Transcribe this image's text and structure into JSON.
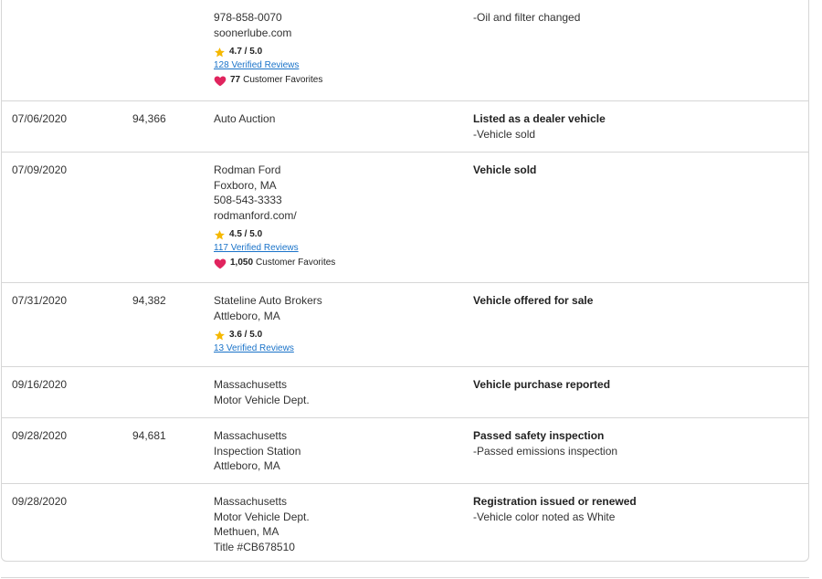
{
  "records": [
    {
      "date": "",
      "mileage": "",
      "source": [
        "978-858-0070",
        "soonerlube.com"
      ],
      "rating": "4.7 / 5.0",
      "reviews": "128 Verified Reviews",
      "favorites_count": "77",
      "favorites_label": "Customer Favorites",
      "title": "",
      "subs": [
        "-Oil and filter changed"
      ]
    },
    {
      "date": "07/06/2020",
      "mileage": "94,366",
      "source": [
        "Auto Auction"
      ],
      "title": "Listed as a dealer vehicle",
      "subs": [
        "-Vehicle sold"
      ]
    },
    {
      "date": "07/09/2020",
      "mileage": "",
      "source": [
        "Rodman Ford",
        "Foxboro, MA",
        "508-543-3333",
        "rodmanford.com/"
      ],
      "rating": "4.5 / 5.0",
      "reviews": "117 Verified Reviews",
      "favorites_count": "1,050",
      "favorites_label": "Customer Favorites",
      "title": "Vehicle sold",
      "subs": []
    },
    {
      "date": "07/31/2020",
      "mileage": "94,382",
      "source": [
        "Stateline Auto Brokers",
        "Attleboro, MA"
      ],
      "rating": "3.6 / 5.0",
      "reviews": "13 Verified Reviews",
      "title": "Vehicle offered for sale",
      "subs": []
    },
    {
      "date": "09/16/2020",
      "mileage": "",
      "source": [
        "Massachusetts",
        "Motor Vehicle Dept."
      ],
      "title": "Vehicle purchase reported",
      "subs": []
    },
    {
      "date": "09/28/2020",
      "mileage": "94,681",
      "source": [
        "Massachusetts",
        "Inspection Station",
        "Attleboro, MA"
      ],
      "title": "Passed safety inspection",
      "subs": [
        "-Passed emissions inspection"
      ]
    },
    {
      "date": "09/28/2020",
      "mileage": "",
      "source": [
        "Massachusetts",
        "Motor Vehicle Dept.",
        "Methuen, MA",
        "Title #CB678510"
      ],
      "title": "Registration issued or renewed",
      "subs": [
        "-Vehicle color noted as White"
      ]
    }
  ],
  "colors": {
    "star": "#f5b800",
    "heart": "#e0245e",
    "link": "#1a73c9",
    "border": "#d6d6d6"
  },
  "icons": {
    "rating": "star-icon",
    "favorites": "heart-icon"
  }
}
